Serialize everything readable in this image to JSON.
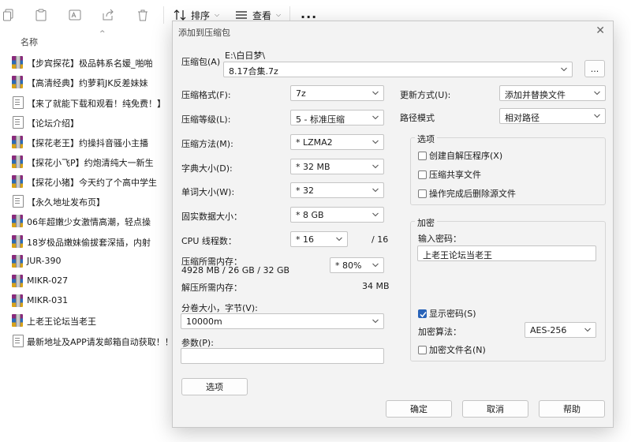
{
  "explorer": {
    "toolbar": {
      "sort_label": "排序",
      "view_label": "查看",
      "more_label": "..."
    },
    "column_header": {
      "name": "名称"
    },
    "files": [
      {
        "name": "【步宾探花】极品韩系名媛_啪啪",
        "type": "archive"
      },
      {
        "name": "【高清经典】约萝莉JK反差妹妹",
        "type": "archive"
      },
      {
        "name": "【来了就能下载和观看！纯免费！】",
        "type": "text"
      },
      {
        "name": "【论坛介绍】",
        "type": "text"
      },
      {
        "name": "【探花老王】约操抖音骚小主播",
        "type": "archive"
      },
      {
        "name": "【探花小飞P】约炮清纯大一新生",
        "type": "archive"
      },
      {
        "name": "【探花小猪】今天约了个高中学生",
        "type": "archive"
      },
      {
        "name": "【永久地址发布页】",
        "type": "text"
      },
      {
        "name": "06年超嫩少女激情高潮，轻点操",
        "type": "archive"
      },
      {
        "name": "18岁极品嫩妹偷拔套深插，内射",
        "type": "archive"
      },
      {
        "name": "JUR-390",
        "type": "archive"
      },
      {
        "name": "MIKR-027",
        "type": "archive"
      },
      {
        "name": "MIKR-031",
        "type": "archive"
      },
      {
        "name": "上老王论坛当老王",
        "type": "archive"
      },
      {
        "name": "最新地址及APP请发邮箱自动获取！！",
        "type": "text"
      }
    ]
  },
  "dialog": {
    "title": "添加到压缩包",
    "close_glyph": "✕",
    "archive_label": "压缩包(A)",
    "archive_path": "E:\\白日梦\\",
    "archive_name": "8.17合集.7z",
    "browse_label": "...",
    "format_label": "压缩格式(F):",
    "format_value": "7z",
    "level_label": "压缩等级(L):",
    "level_value": "5 - 标准压缩",
    "method_label": "压缩方法(M):",
    "method_value": "* LZMA2",
    "dict_label": "字典大小(D):",
    "dict_value": "* 32 MB",
    "word_label": "单词大小(W):",
    "word_value": "* 32",
    "solid_label": "固实数据大小：",
    "solid_value": "* 8 GB",
    "threads_label": "CPU 线程数：",
    "threads_value": "* 16",
    "threads_total": "/ 16",
    "mem_compress_label": "压缩所需内存：",
    "mem_compress_detail": "4928 MB / 26 GB / 32 GB",
    "mem_percent_value": "* 80%",
    "mem_decompress_label": "解压所需内存：",
    "mem_decompress_value": "34 MB",
    "volume_label": "分卷大小，字节(V):",
    "volume_value": "10000m",
    "params_label": "参数(P):",
    "params_value": "",
    "options_button": "选项",
    "update_label": "更新方式(U):",
    "update_value": "添加并替换文件",
    "path_mode_label": "路径模式",
    "path_mode_value": "相对路径",
    "options_group": {
      "title": "选项",
      "sfx": "创建自解压程序(X)",
      "shared": "压缩共享文件",
      "delete_after": "操作完成后删除源文件"
    },
    "encryption_group": {
      "title": "加密",
      "password_label": "输入密码：",
      "password_value": "上老王论坛当老王",
      "show_password": "显示密码(S)",
      "method_label": "加密算法：",
      "method_value": "AES-256",
      "encrypt_names": "加密文件名(N)"
    },
    "ok_button": "确定",
    "cancel_button": "取消",
    "help_button": "帮助"
  }
}
